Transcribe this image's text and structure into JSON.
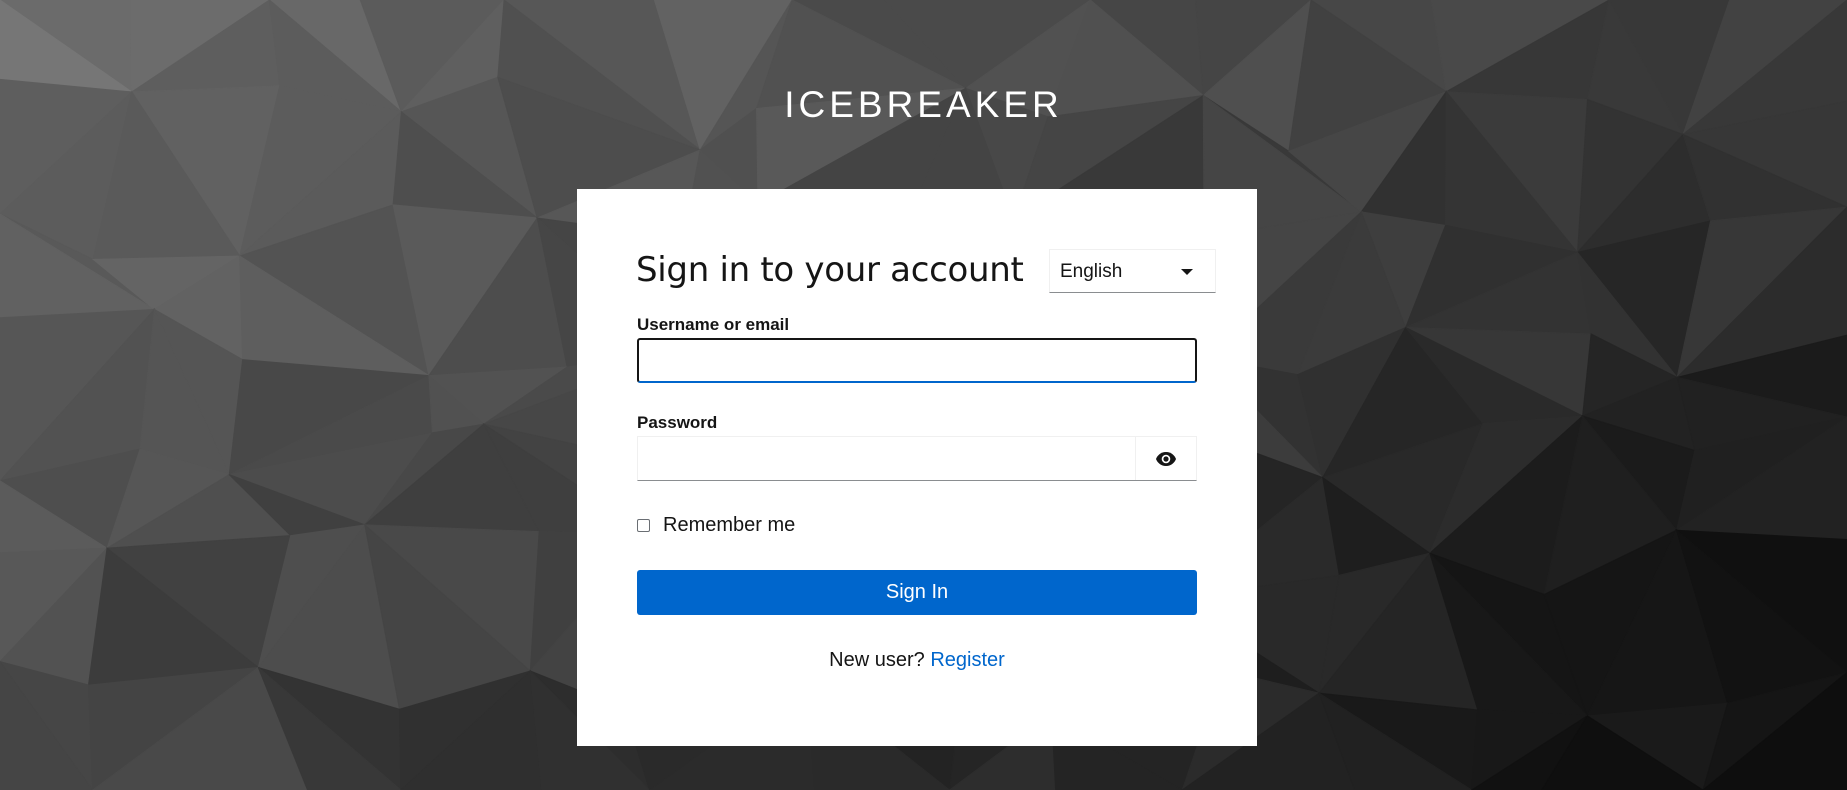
{
  "brand": {
    "title": "ICEBREAKER"
  },
  "login": {
    "title": "Sign in to your account",
    "language": {
      "selected": "English"
    },
    "username": {
      "label": "Username or email",
      "value": ""
    },
    "password": {
      "label": "Password",
      "value": ""
    },
    "remember_me": {
      "label": "Remember me",
      "checked": false
    },
    "submit_label": "Sign In",
    "new_user_text": "New user?",
    "register_link": "Register"
  },
  "colors": {
    "accent": "#0066cc",
    "card_background": "#ffffff",
    "text": "#151515"
  },
  "icons": {
    "language_dropdown": "caret-down-icon",
    "password_toggle": "eye-icon"
  }
}
